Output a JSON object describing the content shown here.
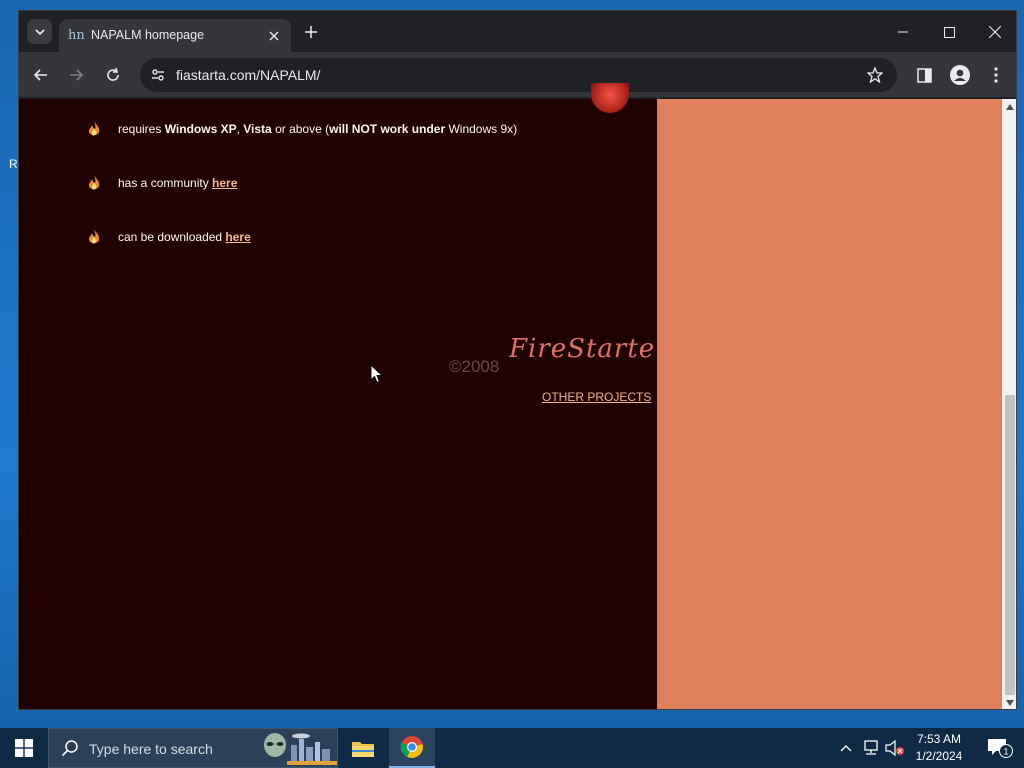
{
  "desktop": {
    "peek_text": "R"
  },
  "browser": {
    "tab": {
      "title": "NAPALM homepage",
      "favicon_icon": "napalm-favicon-icon"
    },
    "url": "fiastarta.com/NAPALM/"
  },
  "page": {
    "items": [
      {
        "id": "requires",
        "parts": [
          "requires ",
          "Windows XP",
          ", ",
          "Vista",
          " or above (",
          "will NOT work under",
          " Windows 9x)"
        ]
      },
      {
        "id": "community",
        "text": "has a community ",
        "link": "here"
      },
      {
        "id": "download",
        "text": "can be downloaded ",
        "link": "here"
      }
    ],
    "copyright": "©2008",
    "logo_text": "FireStarter",
    "other_projects": "OTHER PROJECTS"
  },
  "taskbar": {
    "search_placeholder": "Type here to search",
    "time": "7:53 AM",
    "date": "1/2/2024",
    "notification_count": "1"
  },
  "colors": {
    "page_bg": "#210000",
    "side_panel": "#df7f5c",
    "link": "#f7b891",
    "text": "#fff9e6"
  }
}
